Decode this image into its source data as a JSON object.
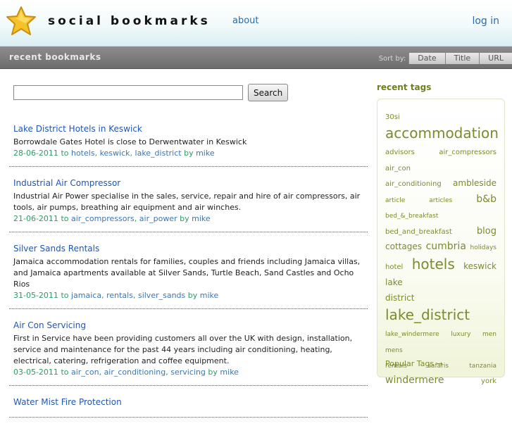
{
  "header": {
    "site_title": "social bookmarks",
    "nav_about": "about",
    "nav_login": "log in"
  },
  "bar": {
    "title": "recent bookmarks",
    "sort_label": "Sort by:",
    "sort_buttons": [
      "Date",
      "Title",
      "URL"
    ]
  },
  "search": {
    "button_label": "Search",
    "value": ""
  },
  "bookmarks": [
    {
      "title": "Lake District Hotels in Keswick",
      "description": "Borrowdale Gates Hotel is close to Derwentwater in Keswick",
      "date": "28-06-2011",
      "to": "to",
      "tags": [
        "hotels",
        "keswick",
        "lake_district"
      ],
      "by": "by",
      "user": "mike"
    },
    {
      "title": "Industrial Air Compressor",
      "description": "Industrial Air Power specialise in the sales, service, repair and hire of air compressors, air tools, air pumps, breathing air equipment and air winches.",
      "date": "21-06-2011",
      "to": "to",
      "tags": [
        "air_compressors",
        "air_power"
      ],
      "by": "by",
      "user": "mike"
    },
    {
      "title": "Silver Sands Rentals",
      "description": "Jamaica accommodation rentals for families, couples and friends including Jamaica villas, and Jamaica apartments available at Silver Sands, Turtle Beach, Sand Castles and Ocho Rios",
      "date": "31-05-2011",
      "to": "to",
      "tags": [
        "jamaica",
        "rentals",
        "silver_sands"
      ],
      "by": "by",
      "user": "mike"
    },
    {
      "title": "Air Con Servicing",
      "description": "First in Service have been providing customers all over the UK with design, installation, service and maintenance for the past 44 years including air conditioning, heating, electrical, catering, refrigeration and coffee equipment.",
      "date": "03-05-2011",
      "to": "to",
      "tags": [
        "air_con",
        "air_conditioning",
        "servicing"
      ],
      "by": "by",
      "user": "mike"
    },
    {
      "title": "Water Mist Fire Protection"
    }
  ],
  "sidebar": {
    "title": "recent tags",
    "popular_link": "Popular Tags →",
    "tag_rows": [
      [
        {
          "name": "30si",
          "size": 10
        }
      ],
      [
        {
          "name": "accommodation",
          "size": 20
        }
      ],
      [
        {
          "name": "advisors",
          "size": 10
        },
        {
          "name": "air_compressors",
          "size": 10
        },
        {
          "name": "air_con",
          "size": 10
        }
      ],
      [
        {
          "name": "air_conditioning",
          "size": 10
        },
        {
          "name": "ambleside",
          "size": 12
        }
      ],
      [
        {
          "name": "article",
          "size": 9
        },
        {
          "name": "articles",
          "size": 9
        },
        {
          "name": "b&b",
          "size": 14
        }
      ],
      [
        {
          "name": "bed_&_breakfast",
          "size": 9
        }
      ],
      [
        {
          "name": "bed_and_breakfast",
          "size": 10
        },
        {
          "name": "blog",
          "size": 13
        }
      ],
      [
        {
          "name": "cottages",
          "size": 12
        },
        {
          "name": "cumbria",
          "size": 14
        },
        {
          "name": "holidays",
          "size": 9
        }
      ],
      [
        {
          "name": "hotel",
          "size": 10
        },
        {
          "name": "hotels",
          "size": 20
        },
        {
          "name": "keswick",
          "size": 12
        },
        {
          "name": "lake",
          "size": 12
        }
      ],
      [
        {
          "name": "district",
          "size": 12
        },
        {
          "name": "lake_district",
          "size": 20
        }
      ],
      [
        {
          "name": "lake_windermere",
          "size": 9
        },
        {
          "name": "luxury",
          "size": 9
        },
        {
          "name": "men",
          "size": 9
        },
        {
          "name": "mens",
          "size": 9
        }
      ],
      [
        {
          "name": "rentals",
          "size": 9
        },
        {
          "name": "safaris",
          "size": 9
        },
        {
          "name": "tanzania",
          "size": 9
        }
      ],
      [
        {
          "name": "windermere",
          "size": 14
        },
        {
          "name": "york",
          "size": 10
        }
      ]
    ]
  },
  "colors": {
    "link_blue": "#1f56b3",
    "meta_green": "#2f9a64",
    "tag_olive": "#7c8a2c",
    "bar_grey": "#7a7a7a"
  },
  "icons": {
    "logo": "star-icon"
  }
}
